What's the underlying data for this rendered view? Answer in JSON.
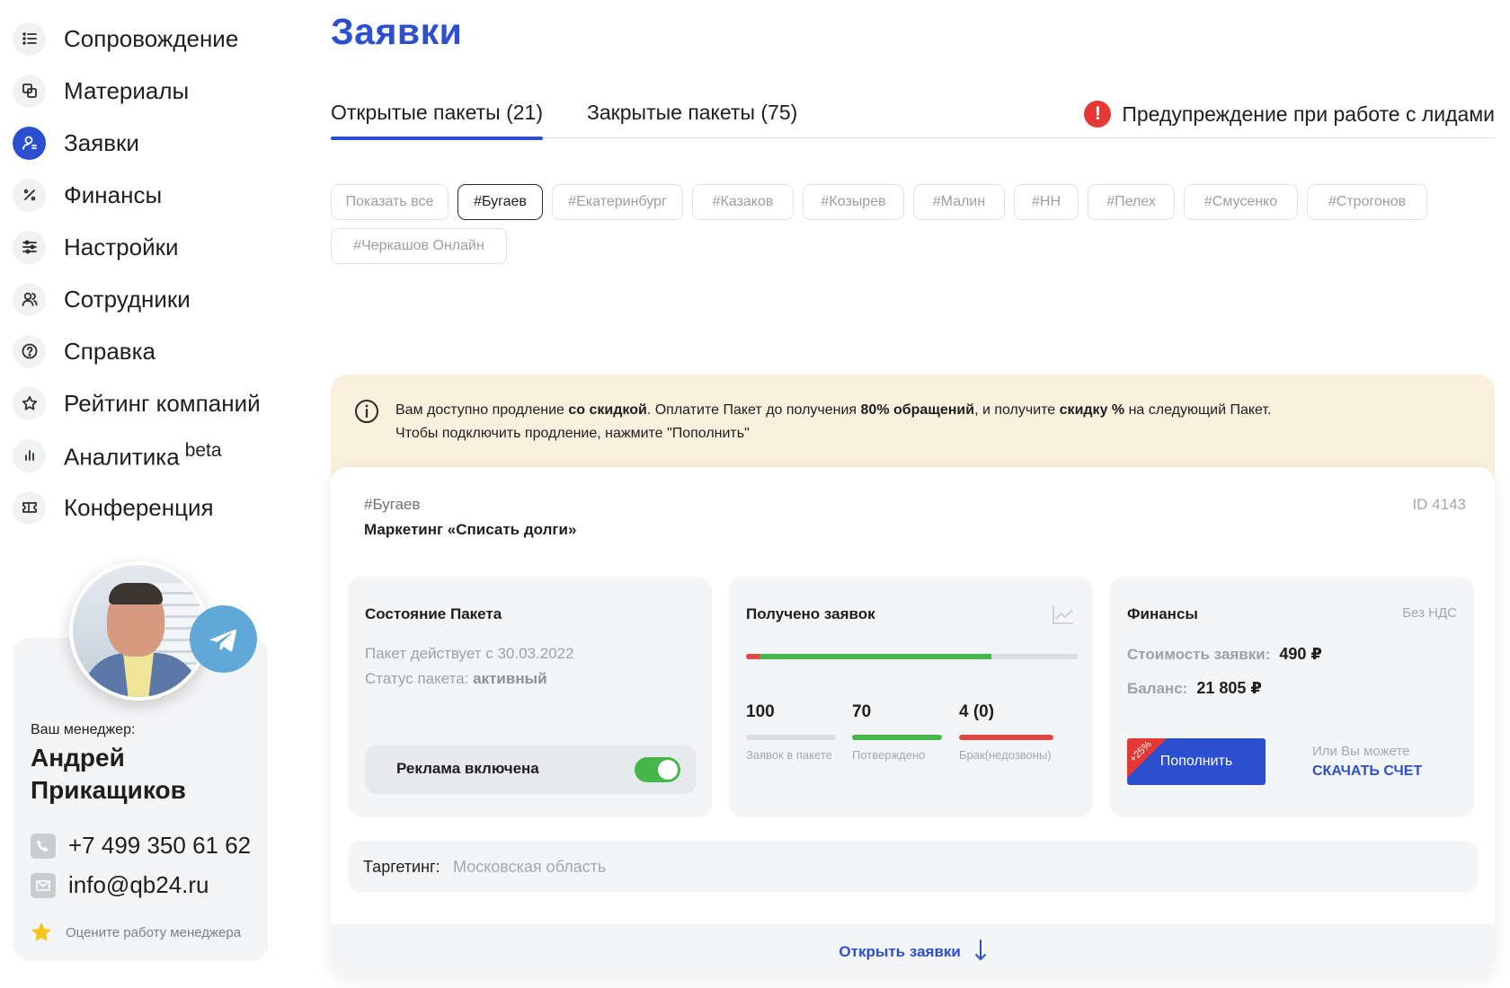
{
  "sidebar": {
    "items": [
      {
        "label": "Сопровождение",
        "icon": "list-icon"
      },
      {
        "label": "Материалы",
        "icon": "copy-icon"
      },
      {
        "label": "Заявки",
        "icon": "user-icon",
        "active": true
      },
      {
        "label": "Финансы",
        "icon": "percent-icon"
      },
      {
        "label": "Настройки",
        "icon": "sliders-icon"
      },
      {
        "label": "Сотрудники",
        "icon": "users-icon"
      },
      {
        "label": "Справка",
        "icon": "help-icon"
      },
      {
        "label": "Рейтинг компаний",
        "icon": "star-icon"
      },
      {
        "label": "Аналитика",
        "icon": "bar-chart-icon",
        "badge": "beta"
      },
      {
        "label": "Конференция",
        "icon": "ticket-icon"
      }
    ],
    "manager": {
      "caption": "Ваш менеджер:",
      "name": "Андрей Прикащиков",
      "phone": "+7 499 350 61 62",
      "email": "info@qb24.ru",
      "rate_label": "Оцените работу менеджера"
    }
  },
  "main": {
    "title": "Заявки",
    "tabs": [
      {
        "label": "Открытые пакеты (21)",
        "active": true
      },
      {
        "label": "Закрытые пакеты (75)",
        "active": false
      }
    ],
    "warning_label": "Предупреждение при работе с лидами",
    "filters": [
      {
        "label": "Показать все",
        "active": false
      },
      {
        "label": "#Бугаев",
        "active": true
      },
      {
        "label": "#Екатеринбург",
        "active": false
      },
      {
        "label": "#Казаков",
        "active": false
      },
      {
        "label": "#Козырев",
        "active": false
      },
      {
        "label": "#Малин",
        "active": false
      },
      {
        "label": "#НН",
        "active": false
      },
      {
        "label": "#Пелех",
        "active": false
      },
      {
        "label": "#Смусенко",
        "active": false
      },
      {
        "label": "#Строгонов",
        "active": false
      },
      {
        "label": "#Черкашов Онлайн",
        "active": false
      }
    ],
    "notice": {
      "p1": "Вам доступно продление ",
      "b1": "со скидкой",
      "p2": ". Оплатите Пакет до получения ",
      "b2": "80% обращений",
      "p3": ", и получите ",
      "b3": "скидку %",
      "p4": " на следующий Пакет.",
      "line2": "Чтобы подключить продление, нажмите \"Пополнить\""
    },
    "package": {
      "tag": "#Бугаев",
      "name": "Маркетинг «Списать долги»",
      "id": "ID 4143",
      "state": {
        "title": "Состояние Пакета",
        "since": "Пакет действует с 30.03.2022",
        "status_label": "Статус пакета: ",
        "status_value": "активный",
        "ad_label": "Реклама включена",
        "ad_enabled": true
      },
      "received": {
        "title": "Получено заявок",
        "total": "100",
        "total_caption": "Заявок в пакете",
        "confirmed": "70",
        "confirmed_caption": "Потверждено",
        "rejected": "4 (0)",
        "rejected_caption": "Брак(недозвоны)",
        "progress": {
          "rejected_fraction": 0.04,
          "confirmed_fraction": 0.7
        },
        "colors": {
          "confirmed": "#45b649",
          "rejected": "#e04545"
        }
      },
      "finance": {
        "title": "Финансы",
        "vat_note": "Без НДС",
        "price_label": "Стоимость заявки:",
        "price_value": "490 ₽",
        "balance_label": "Баланс:",
        "balance_value": "21 805 ₽",
        "topup_label": "Пополнить",
        "topup_badge": "+25%",
        "alt_text": "Или Вы можете",
        "invoice_label": "Скачать счет"
      },
      "targeting_label": "Таргетинг:",
      "targeting_value": "Московская область",
      "open_label": "Открыть заявки"
    }
  },
  "colors": {
    "accent": "#2b4fcf",
    "warning": "#e53935",
    "success": "#45b649",
    "notice_bg": "#faf0de"
  }
}
